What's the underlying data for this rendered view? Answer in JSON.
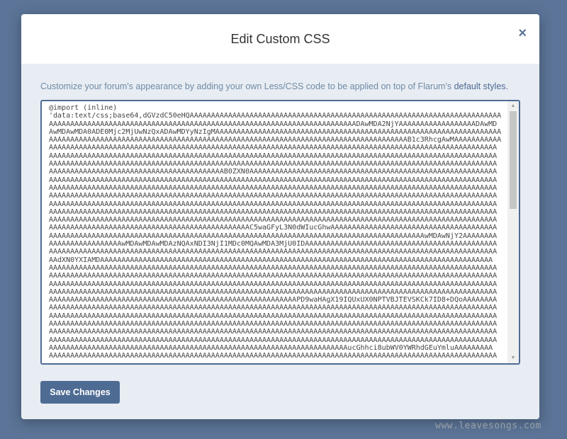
{
  "modal": {
    "title": "Edit Custom CSS",
    "close_icon": "×",
    "description": "Customize your forum's appearance by adding your own Less/CSS code to be applied on top of Flarum's ",
    "description_link": "default styles.",
    "css_lines": [
      "@import (inline)",
      "'data:text/css;base64,dGVzdC50eHQAAAAAAAAAAAAAAAAAAAAAAAAAAAAAAAAAAAAAAAAAAAAAAAAAAAAAAAAAAAAAAAAAAAAAAAAA",
      "AAAAAAAAAAAAAAAAAAAAAAAAAAAAAAAAAAAAAAAAAAAAAAAAAAAAAAAAAAAAAAAAAAAAAAAADAwMDA2NjYAAAAAAAAAAAAAAAAAADAwMD",
      "AwMDAwMDA0ADE0Mjc2MjUwNzQxADAwMDYyNzIgMAAAAAAAAAAAAAAAAAAAAAAAAAAAAAAAAAAAAAAAAAAAAAAAAAAAAAAAAAAAAAAAAAAA",
      "AAAAAAAAAAAAAAAAAAAAAAAAAAAAAAAAAAAAAAAAAAAAAAAAAAAAAAAAAAAAAAAAAAAAAAAAAAAAAAAAAAAAB1c3RhcgAwMAAAAAAAAAAA",
      "AAAAAAAAAAAAAAAAAAAAAAAAAAAAAAAAAAAAAAAAAAAAAAAAAAAAAAAAAAAAAAAAAAAAAAAAAAAAAAAAAAAAAAAAAAAAAAAAAAAAAAAAA",
      "AAAAAAAAAAAAAAAAAAAAAAAAAAAAAAAAAAAAAAAAAAAAAAAAAAAAAAAAAAAAAAAAAAAAAAAAAAAAAAAAAAAAAAAAAAAAAAAAAAAAAAAAA",
      "AAAAAAAAAAAAAAAAAAAAAAAAAAAAAAAAAAAAAAAAAAAAAAAAAAAAAAAAAAAAAAAAAAAAAAAAAAAAAAAAAAAAAAAAAAAAAAAAAAAAAAAAA",
      "AAAAAAAAAAAAAAAAAAAAAAAAAAAAAAAAAAAAAAAAAB0ZXN0AAAAAAAAAAAAAAAAAAAAAAAAAAAAAAAAAAAAAAAAAAAAAAAAAAAAAAAAAA",
      "AAAAAAAAAAAAAAAAAAAAAAAAAAAAAAAAAAAAAAAAAAAAAAAAAAAAAAAAAAAAAAAAAAAAAAAAAAAAAAAAAAAAAAAAAAAAAAAAAAAAAAAAA",
      "AAAAAAAAAAAAAAAAAAAAAAAAAAAAAAAAAAAAAAAAAAAAAAAAAAAAAAAAAAAAAAAAAAAAAAAAAAAAAAAAAAAAAAAAAAAAAAAAAAAAAAAAA",
      "AAAAAAAAAAAAAAAAAAAAAAAAAAAAAAAAAAAAAAAAAAAAAAAAAAAAAAAAAAAAAAAAAAAAAAAAAAAAAAAAAAAAAAAAAAAAAAAAAAAAAAAAA",
      "AAAAAAAAAAAAAAAAAAAAAAAAAAAAAAAAAAAAAAAAAAAAAAAAAAAAAAAAAAAAAAAAAAAAAAAAAAAAAAAAAAAAAAAAAAAAAAAAAAAAAAAAA",
      "AAAAAAAAAAAAAAAAAAAAAAAAAAAAAAAAAAAAAAAAAAAAAAAAAAAAAAAAAAAAAAAAAAAAAAAAAAAAAAAAAAAAAAAAAAAAAAAAAAAAAAAAA",
      "AAAAAAAAAAAAAAAAAAAAAAAAAAAAAAAAAAAAAAAAAAAAAAAAAAAAAAAAAAAAAAAAAAAAAAAAAAAAAAAAAAAAAAAAAAAAAAAAAAAAAAAAA",
      "AAAAAAAAAAAAAAAAAAAAAAAAAAAAAAAAAAAAAAAAAAAAAAAC5waGFyL3N0dWIucGhwAAAAAAAAAAAAAAAAAAAAAAAAAAAAAAAAAAAAAAA",
      "AAAAAAAAAAAAAAAAAAAAAAAAAAAAAAAAAAAAAAAAAAAAAAAAAAAAAAAAAAAAAAAAAAAAAAAAAAAAAAAAAAAAAAAAwMDAwNjY2AAAAAAAA",
      "AAAAAAAAAAAAAAAAAwMDAwMDAwMDAzNQAxNDI3NjI1MDc0MQAwMDA3MjU0IDAAAAAAAAAAAAAAAAAAAAAAAAAAAAAAAAAAAAAAAAAAAAA",
      "AAAAAAAAAAAAAAAAAAAAAAAAAAAAAAAAAAAAAAAAAAAAAAAAAAAAAAAAAAAAAAAAAAAAAAAAAAAAAAAAAAAAAAAAAAAAAAAAAAAAAAAAA",
      "AAdXN0YXIAMDAAAAAAAAAAAAAAAAAAAAAAAAAAAAAAAAAAAAAAAAAAAAAAAAAAAAAAAAAAAAAAAAAAAAAAAAAAAAAAAAAAAAAAAAAAAA",
      "AAAAAAAAAAAAAAAAAAAAAAAAAAAAAAAAAAAAAAAAAAAAAAAAAAAAAAAAAAAAAAAAAAAAAAAAAAAAAAAAAAAAAAAAAAAAAAAAAAAAAAAAA",
      "AAAAAAAAAAAAAAAAAAAAAAAAAAAAAAAAAAAAAAAAAAAAAAAAAAAAAAAAAAAAAAAAAAAAAAAAAAAAAAAAAAAAAAAAAAAAAAAAAAAAAAAAA",
      "AAAAAAAAAAAAAAAAAAAAAAAAAAAAAAAAAAAAAAAAAAAAAAAAAAAAAAAAAAAAAAAAAAAAAAAAAAAAAAAAAAAAAAAAAAAAAAAAAAAAAAAAA",
      "AAAAAAAAAAAAAAAAAAAAAAAAAAAAAAAAAAAAAAAAAAAAAAAAAAAAAAAAAAAAAAAAAAAAAAAAAAAAAAAAAAAAAAAAAAAAAAAAAAAAAAAAA",
      "AAAAAAAAAAAAAAAAAAAAAAAAAAAAAAAAAAAAAAAAAAAAAAAAAAAAAAAAAAPD9waHAgX19IQUxUX0NPTVBJTEVSKCk7ID8+DQoAAAAAAAA",
      "AAAAAAAAAAAAAAAAAAAAAAAAAAAAAAAAAAAAAAAAAAAAAAAAAAAAAAAAAAAAAAAAAAAAAAAAAAAAAAAAAAAAAAAAAAAAAAAAAAAAAAAAA",
      "AAAAAAAAAAAAAAAAAAAAAAAAAAAAAAAAAAAAAAAAAAAAAAAAAAAAAAAAAAAAAAAAAAAAAAAAAAAAAAAAAAAAAAAAAAAAAAAAAAAAAAAAA",
      "AAAAAAAAAAAAAAAAAAAAAAAAAAAAAAAAAAAAAAAAAAAAAAAAAAAAAAAAAAAAAAAAAAAAAAAAAAAAAAAAAAAAAAAAAAAAAAAAAAAAAAAAA",
      "AAAAAAAAAAAAAAAAAAAAAAAAAAAAAAAAAAAAAAAAAAAAAAAAAAAAAAAAAAAAAAAAAAAAAAAAAAAAAAAAAAAAAAAAAAAAAAAAAAAAAAAAA",
      "AAAAAAAAAAAAAAAAAAAAAAAAAAAAAAAAAAAAAAAAAAAAAAAAAAAAAAAAAAAAAAAAAAAAAAAAAAAAAAAAAAAAAAAAAAAAAAAAAAAAAAAAA",
      "AAAAAAAAAAAAAAAAAAAAAAAAAAAAAAAAAAAAAAAAAAAAAAAAAAAAAAAAAAAAAAAAAAAAAAucGhhci8ubWV0YWRhdGEuYmluAAAAAAAAA",
      "AAAAAAAAAAAAAAAAAAAAAAAAAAAAAAAAAAAAAAAAAAAAAAAAAAAAAAAAAAAAAAAAAAAAAAAAAAAAAAAAAAAAAAAAAAAAAAAAAAAAAAAAA"
    ],
    "save_label": "Save Changes"
  },
  "watermark": "www.leavesongs.com",
  "colors": {
    "backdrop": "#5b7497",
    "primary": "#4e6b93",
    "modal_body": "#e8edf3",
    "description_text": "#6f8aa6"
  }
}
